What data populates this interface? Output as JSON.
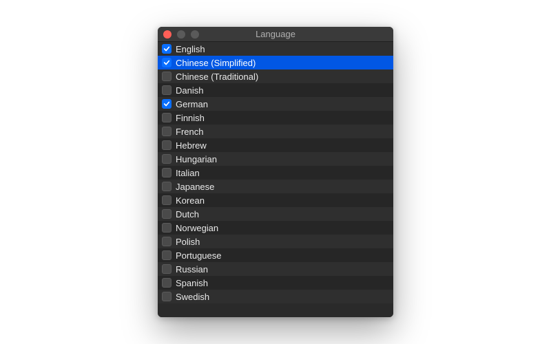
{
  "window": {
    "title": "Language"
  },
  "languages": [
    {
      "label": "English",
      "checked": true,
      "selected": false
    },
    {
      "label": "Chinese (Simplified)",
      "checked": true,
      "selected": true
    },
    {
      "label": "Chinese (Traditional)",
      "checked": false,
      "selected": false
    },
    {
      "label": "Danish",
      "checked": false,
      "selected": false
    },
    {
      "label": "German",
      "checked": true,
      "selected": false
    },
    {
      "label": "Finnish",
      "checked": false,
      "selected": false
    },
    {
      "label": "French",
      "checked": false,
      "selected": false
    },
    {
      "label": "Hebrew",
      "checked": false,
      "selected": false
    },
    {
      "label": "Hungarian",
      "checked": false,
      "selected": false
    },
    {
      "label": "Italian",
      "checked": false,
      "selected": false
    },
    {
      "label": "Japanese",
      "checked": false,
      "selected": false
    },
    {
      "label": "Korean",
      "checked": false,
      "selected": false
    },
    {
      "label": "Dutch",
      "checked": false,
      "selected": false
    },
    {
      "label": "Norwegian",
      "checked": false,
      "selected": false
    },
    {
      "label": "Polish",
      "checked": false,
      "selected": false
    },
    {
      "label": "Portuguese",
      "checked": false,
      "selected": false
    },
    {
      "label": "Russian",
      "checked": false,
      "selected": false
    },
    {
      "label": "Spanish",
      "checked": false,
      "selected": false
    },
    {
      "label": "Swedish",
      "checked": false,
      "selected": false
    }
  ]
}
